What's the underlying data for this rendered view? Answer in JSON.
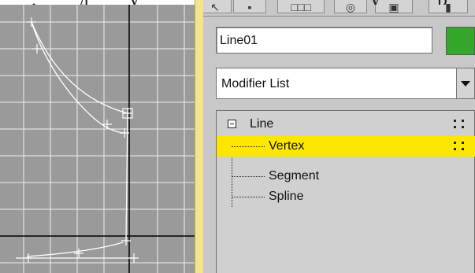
{
  "page_text": {
    "left": ",",
    "mid": "д",
    "mid2": "у",
    "right": "у",
    "right2": "р"
  },
  "viewport": {
    "grid_color": "#ffffff",
    "background": "#9a9a9a",
    "axis_color": "#000000"
  },
  "toolbar": {
    "buttons": [
      {
        "icon": "pointer-icon",
        "glyph": "↖"
      },
      {
        "icon": "display-icon",
        "glyph": "▪"
      },
      {
        "icon": "hierarchy-icon",
        "glyph": "□□□"
      },
      {
        "icon": "motion-icon",
        "glyph": "◎"
      },
      {
        "icon": "utilities-icon",
        "glyph": "▣"
      },
      {
        "icon": "hammer-icon",
        "glyph": "▮"
      }
    ]
  },
  "object_name": {
    "value": "Line01"
  },
  "object_color": "#35a82c",
  "modifier_list": {
    "label": "Modifier List"
  },
  "stack": {
    "items": [
      {
        "label": "Line",
        "level": 0,
        "expander": "−",
        "has_dots": true
      },
      {
        "label": "Vertex",
        "level": 1,
        "selected": true,
        "has_dots": true
      },
      {
        "label": "Segment",
        "level": 1
      },
      {
        "label": "Spline",
        "level": 1
      }
    ],
    "selected_color": "#fde600"
  }
}
